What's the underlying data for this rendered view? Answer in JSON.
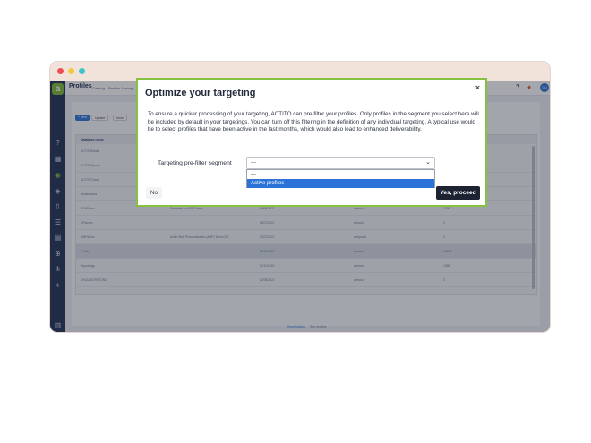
{
  "window": {
    "colors": {
      "close": "#ee4b52",
      "minimize": "#f6c741",
      "zoom": "#3cc4c9"
    }
  },
  "topbar": {
    "title": "Profiles",
    "links": [
      "Catalog",
      "Profiles",
      "Manag"
    ],
    "help": "?",
    "avatar": "GU"
  },
  "toolbar": {
    "new_label": "+ New",
    "update_label": "Update",
    "more_label": "More"
  },
  "grid": {
    "header": "Database name",
    "rows": [
      {
        "name": "ACTITOMedia"
      },
      {
        "name": "ACTITOSports"
      },
      {
        "name": "ACTITOTravel"
      },
      {
        "name": "Amazonians"
      },
      {
        "name": "ADNDemo",
        "desc": "Database for ADN Demo",
        "date": "09/06/2021",
        "owner": "demoui",
        "count": "1000"
      },
      {
        "name": "APIdemo",
        "date": "16/07/2021",
        "owner": "demoui",
        "count": "0"
      },
      {
        "name": "AWPdemo",
        "desc": "Actito Web Personalization (AWP) Demo DB",
        "date": "12/07/2021",
        "owner": "webparse",
        "count": "2"
      },
      {
        "name": "Profiles",
        "date": "15/12/2020",
        "owner": "demoui",
        "count": "10001"
      },
      {
        "name": "Reportings",
        "date": "01/11/2019",
        "owner": "demoui",
        "count": "1398"
      },
      {
        "name": "UNCUNIOTESTING",
        "date": "12/08/2021",
        "owner": "demoui",
        "count": "3"
      }
    ]
  },
  "footer": {
    "show_actions": "Show Actions",
    "see_profiles": "See profiles"
  },
  "modal": {
    "title": "Optimize your targeting",
    "close": "×",
    "description": "To ensure a quicker processing of your targeting, ACTITO can pre-filter your profiles. Only profiles in the segment you select here will be included by default in your targetings. You can turn off this filtering in the definition of any individual targeting. A typical use would be to select profiles that have been active in the last months, which would also lead to enhanced deliverability.",
    "segment_label": "Targeting pre-filter segment",
    "select_value": "---",
    "options": [
      "---",
      "Active profiles"
    ],
    "no_label": "No",
    "yes_label": "Yes, proceed",
    "colors": {
      "border": "#86c23f",
      "highlight": "#2a72d8",
      "primary": "#1d2333"
    }
  }
}
